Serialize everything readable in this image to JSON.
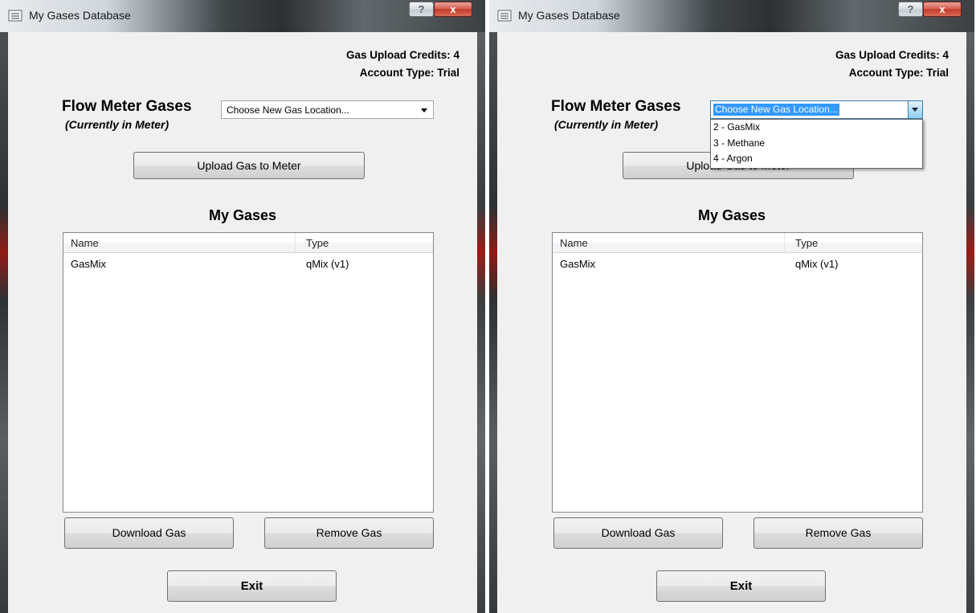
{
  "windows": [
    {
      "title": "My Gases Database",
      "help_label": "?",
      "close_label": "x",
      "credits_label": "Gas Upload Credits:",
      "credits_value": "4",
      "account_label": "Account Type:",
      "account_value": "Trial",
      "flow_meter_title": "Flow Meter Gases",
      "flow_meter_subtitle": "(Currently in Meter)",
      "location_combo": {
        "value": "Choose New Gas Location...",
        "expanded": false,
        "options": []
      },
      "upload_button": "Upload Gas to Meter",
      "my_gases_title": "My Gases",
      "columns": [
        "Name",
        "Type"
      ],
      "rows": [
        {
          "name": "GasMix",
          "type": "qMix (v1)"
        }
      ],
      "download_button": "Download Gas",
      "remove_button": "Remove Gas",
      "exit_button": "Exit"
    },
    {
      "title": "My Gases Database",
      "help_label": "?",
      "close_label": "x",
      "credits_label": "Gas Upload Credits:",
      "credits_value": "4",
      "account_label": "Account Type:",
      "account_value": "Trial",
      "flow_meter_title": "Flow Meter Gases",
      "flow_meter_subtitle": "(Currently in Meter)",
      "location_combo": {
        "value": "Choose New Gas Location...",
        "expanded": true,
        "options": [
          "2 - GasMix",
          "3 - Methane",
          "4 - Argon"
        ]
      },
      "upload_button": "Upload Gas to Meter",
      "my_gases_title": "My Gases",
      "columns": [
        "Name",
        "Type"
      ],
      "rows": [
        {
          "name": "GasMix",
          "type": "qMix (v1)"
        }
      ],
      "download_button": "Download Gas",
      "remove_button": "Remove Gas",
      "exit_button": "Exit"
    }
  ]
}
